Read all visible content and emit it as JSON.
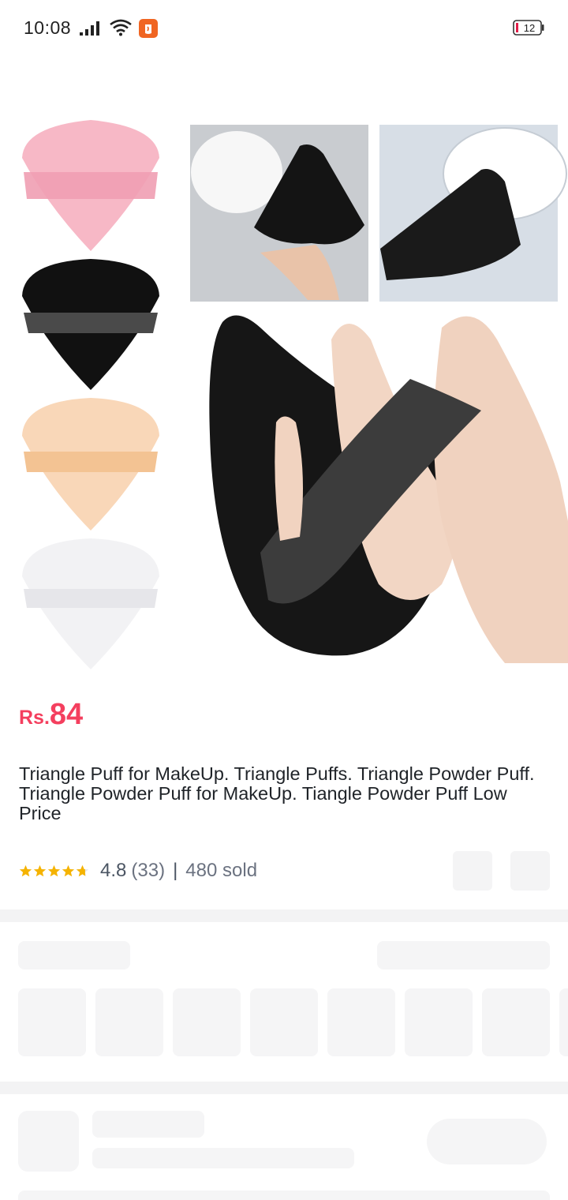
{
  "status_bar": {
    "time": "10:08",
    "battery": "12",
    "icons": [
      "signal-icon",
      "wifi-icon",
      "app-notification-icon",
      "battery-icon"
    ]
  },
  "product": {
    "price_prefix": "Rs.",
    "price_value": "84",
    "title": "Triangle Puff for MakeUp. Triangle Puffs. Triangle Powder Puff. Triangle Powder Puff for MakeUp. Tiangle Powder Puff Low Price",
    "rating": "4.8",
    "reviews": "(33)",
    "separator": "|",
    "sold": "480 sold",
    "star_count": 5
  },
  "colors": {
    "price": "#f43f5e",
    "star": "#f5b301",
    "skeleton": "#f5f5f6",
    "divider": "#f3f3f4"
  }
}
